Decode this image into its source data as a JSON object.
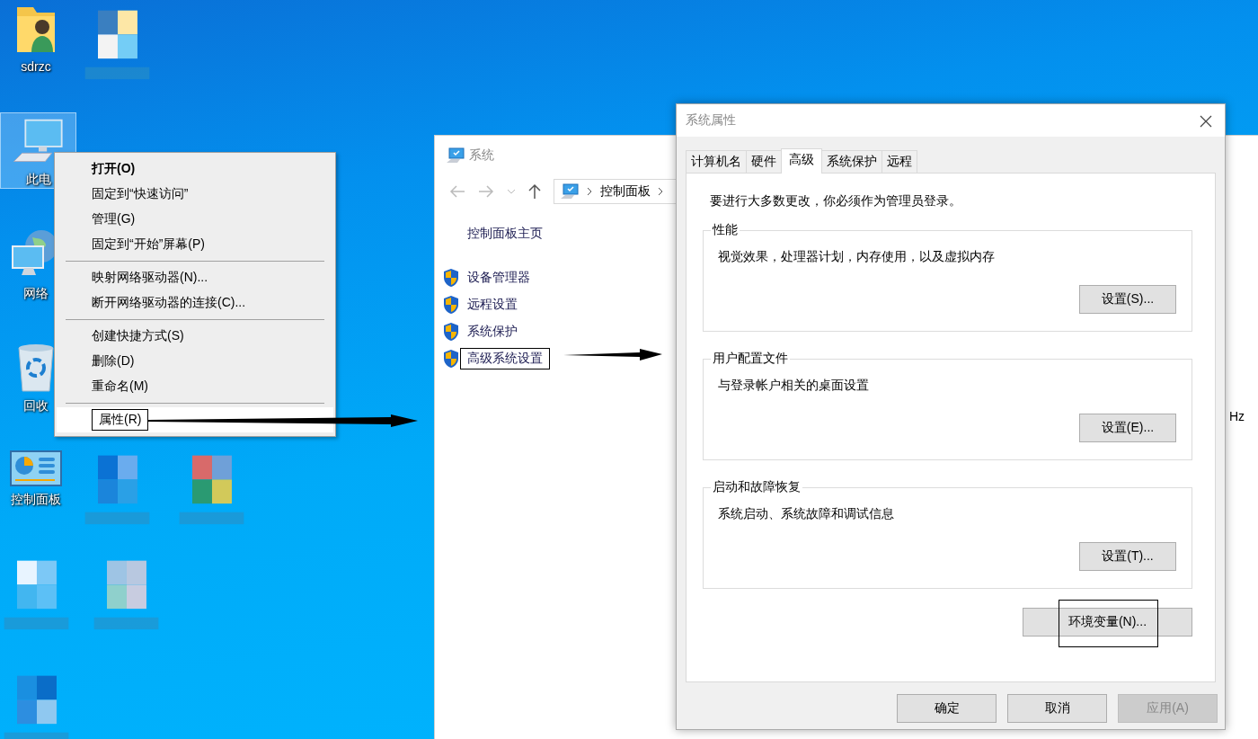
{
  "desktop": {
    "icons": [
      {
        "kind": "user-folder",
        "label": "sdrzc",
        "selected": false
      },
      {
        "kind": "computer",
        "label": "此电",
        "selected": true
      },
      {
        "kind": "network",
        "label": "网络",
        "selected": false
      },
      {
        "kind": "recycle-bin",
        "label": "回收",
        "selected": false
      },
      {
        "kind": "control-panel",
        "label": "控制面板",
        "selected": false
      },
      {
        "kind": "pixelated",
        "selected": false
      },
      {
        "kind": "pixelated",
        "selected": false
      },
      {
        "kind": "pixelated",
        "selected": false
      },
      {
        "kind": "pixelated",
        "selected": false
      },
      {
        "kind": "pixelated",
        "selected": false
      },
      {
        "kind": "pixelated",
        "selected": false
      }
    ]
  },
  "context_menu": {
    "sections": [
      {
        "items": [
          {
            "label": "打开(O)",
            "bold": true,
            "highlighted": false,
            "annotated": false
          },
          {
            "label": "固定到“快速访问”",
            "bold": false,
            "highlighted": false,
            "annotated": false
          },
          {
            "label": "管理(G)",
            "bold": false,
            "highlighted": false,
            "annotated": false
          },
          {
            "label": "固定到“开始”屏幕(P)",
            "bold": false,
            "highlighted": false,
            "annotated": false
          }
        ]
      },
      {
        "items": [
          {
            "label": "映射网络驱动器(N)...",
            "bold": false,
            "highlighted": false,
            "annotated": false
          },
          {
            "label": "断开网络驱动器的连接(C)...",
            "bold": false,
            "highlighted": false,
            "annotated": false
          }
        ]
      },
      {
        "items": [
          {
            "label": "创建快捷方式(S)",
            "bold": false,
            "highlighted": false,
            "annotated": false
          },
          {
            "label": "删除(D)",
            "bold": false,
            "highlighted": false,
            "annotated": false
          },
          {
            "label": "重命名(M)",
            "bold": false,
            "highlighted": false,
            "annotated": false
          }
        ]
      },
      {
        "items": [
          {
            "label": "属性(R)",
            "bold": false,
            "highlighted": true,
            "annotated": true
          }
        ]
      }
    ]
  },
  "system_window": {
    "title": "系统",
    "breadcrumb": [
      "控制面板"
    ],
    "sidebar": {
      "home": "控制面板主页",
      "links": [
        {
          "label": "设备管理器",
          "annotated": false
        },
        {
          "label": "远程设置",
          "annotated": false
        },
        {
          "label": "系统保护",
          "annotated": false
        },
        {
          "label": "高级系统设置",
          "annotated": true
        }
      ]
    },
    "right_text": "Hz"
  },
  "dialog": {
    "title": "系统属性",
    "tabs": [
      {
        "label": "计算机名",
        "selected": false
      },
      {
        "label": "硬件",
        "selected": false
      },
      {
        "label": "高级",
        "selected": true
      },
      {
        "label": "系统保护",
        "selected": false
      },
      {
        "label": "远程",
        "selected": false
      }
    ],
    "note": "要进行大多数更改，你必须作为管理员登录。",
    "groups": [
      {
        "title": "性能",
        "description": "视觉效果，处理器计划，内存使用，以及虚拟内存",
        "button": "设置(S)..."
      },
      {
        "title": "用户配置文件",
        "description": "与登录帐户相关的桌面设置",
        "button": "设置(E)..."
      },
      {
        "title": "启动和故障恢复",
        "description": "系统启动、系统故障和调试信息",
        "button": "设置(T)..."
      }
    ],
    "env_button": {
      "label": "环境变量(N)...",
      "annotated": true
    },
    "footer_buttons": [
      {
        "label": "确定",
        "disabled": false
      },
      {
        "label": "取消",
        "disabled": false
      },
      {
        "label": "应用(A)",
        "disabled": true
      }
    ]
  }
}
